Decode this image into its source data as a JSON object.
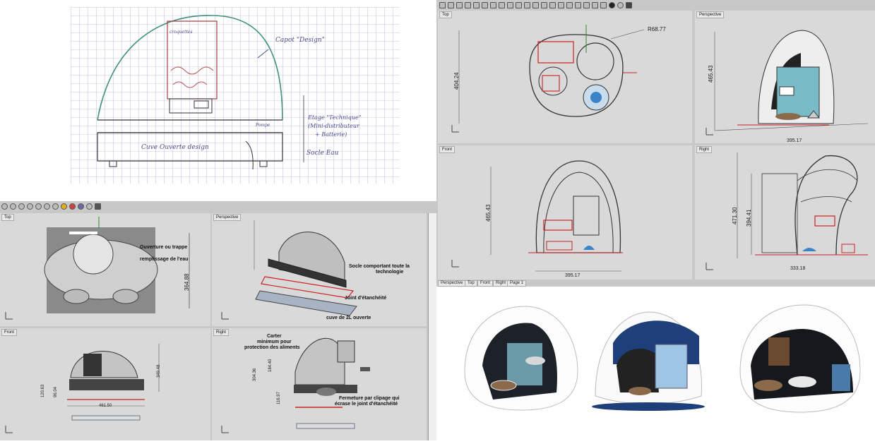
{
  "sketch": {
    "capot_label": "Capot \"Design\"",
    "croquettes_label": "croquettes",
    "etage_label_1": "Etage \"Technique\"",
    "etage_label_2": "(Mini-distributeur",
    "etage_label_3": "+ Batterie)",
    "cuve_label": "Cuve Ouverte design",
    "socle_label": "Socle Eau",
    "pompe_label": "Pompe"
  },
  "cad_left": {
    "top_view": {
      "label": "Top",
      "annotation_1": "Ouverture ou trappe",
      "annotation_2": "remplissage de l'eau",
      "dim_v": "364.88"
    },
    "perspective_view": {
      "label": "Perspective",
      "annotation_socle_1": "Socle comportant toute la",
      "annotation_socle_2": "technologie",
      "annotation_joint": "Joint d'étanchéité",
      "annotation_cuve": "cuve de 2L ouverte"
    },
    "front_view": {
      "label": "Front",
      "dim_1": "120.63",
      "dim_2": "96.04",
      "dim_3": "349.48",
      "dim_w": "461.50"
    },
    "right_view": {
      "label": "Right",
      "annotation_carter_1": "Carter",
      "annotation_carter_2": "minimum pour",
      "annotation_carter_3": "protection des aliments",
      "dim_1": "304.36",
      "dim_2": "184.40",
      "dim_3": "116.97",
      "annotation_fermeture_1": "Fermeture par clipage qui",
      "annotation_fermeture_2": "écrase le joint d'étanchéité"
    }
  },
  "cad_right": {
    "top_view": {
      "label": "Top",
      "dim_radius": "R68.77",
      "dim_v": "404.24"
    },
    "perspective_view": {
      "label": "Perspective",
      "dim_v": "465.43",
      "dim_w": "395.17"
    },
    "front_view": {
      "label": "Front",
      "dim_v": "465.43",
      "dim_w": "395.17"
    },
    "right_view": {
      "label": "Right",
      "dim_v1": "471.30",
      "dim_v2": "394.41",
      "dim_w": "333.18"
    },
    "tabs": [
      "Perspective",
      "Top",
      "Front",
      "Right",
      "Page 1"
    ]
  },
  "colors": {
    "viewport_bg": "#d9d9d9",
    "curve_red": "#cc2222",
    "curve_dark": "#333333",
    "teal": "#4a9aa8",
    "navy": "#1e3f7a"
  }
}
